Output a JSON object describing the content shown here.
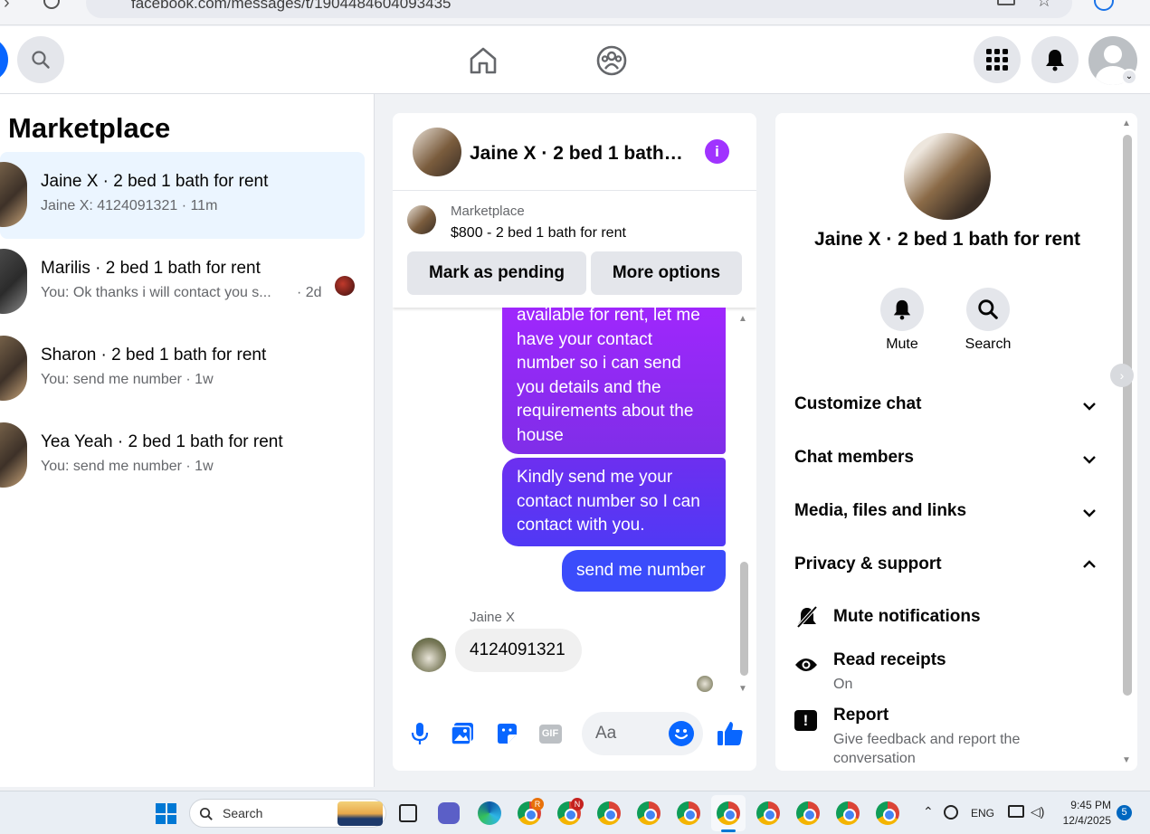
{
  "browser": {
    "url": "facebook.com/messages/t/1904484604093435"
  },
  "left": {
    "title": "Marketplace",
    "conversations": [
      {
        "name": "Jaine X · 2 bed 1 bath for rent",
        "preview": "Jaine X: 4124091321 · 11m"
      },
      {
        "name": "Marilis · 2 bed 1 bath for rent",
        "preview": "You: Ok thanks i will contact you s...",
        "time": "· 2d"
      },
      {
        "name": "Sharon · 2 bed 1 bath for rent",
        "preview": "You: send me number · 1w"
      },
      {
        "name": "Yea Yeah · 2 bed 1 bath for rent",
        "preview": "You: send me number · 1w"
      }
    ]
  },
  "chat": {
    "title": "Jaine X · 2 bed 1 bath…",
    "marketplace_label": "Marketplace",
    "listing": "$800 - 2 bed 1 bath for rent",
    "btn_pending": "Mark as pending",
    "btn_more": "More options",
    "messages": {
      "m1": [
        "available for rent, let me",
        "have your contact",
        "number so i can send",
        "you details and the",
        "requirements about the",
        "house"
      ],
      "m2": [
        "Kindly send me your",
        "contact number so I can",
        "contact with you."
      ],
      "m3": "send me number",
      "sender": "Jaine X",
      "reply": "4124091321"
    },
    "composer_placeholder": "Aa"
  },
  "info": {
    "name": "Jaine X · 2 bed 1 bath for rent",
    "mute_label": "Mute",
    "search_label": "Search",
    "sections": [
      "Customize chat",
      "Chat members",
      "Media, files and links",
      "Privacy & support"
    ],
    "mute_notifications": "Mute notifications",
    "read_receipts": "Read receipts",
    "read_receipts_value": "On",
    "report": "Report",
    "report_desc": [
      "Give feedback and report the",
      "conversation"
    ]
  },
  "taskbar": {
    "search_label": "Search",
    "lang": "ENG",
    "time": "9:45 PM",
    "date": "12/4/2025",
    "notification_count": "5"
  },
  "colors": {
    "accent": "#0866ff",
    "bubble_top": "#a033ff",
    "bubble_bottom": "#3b5bfd"
  }
}
